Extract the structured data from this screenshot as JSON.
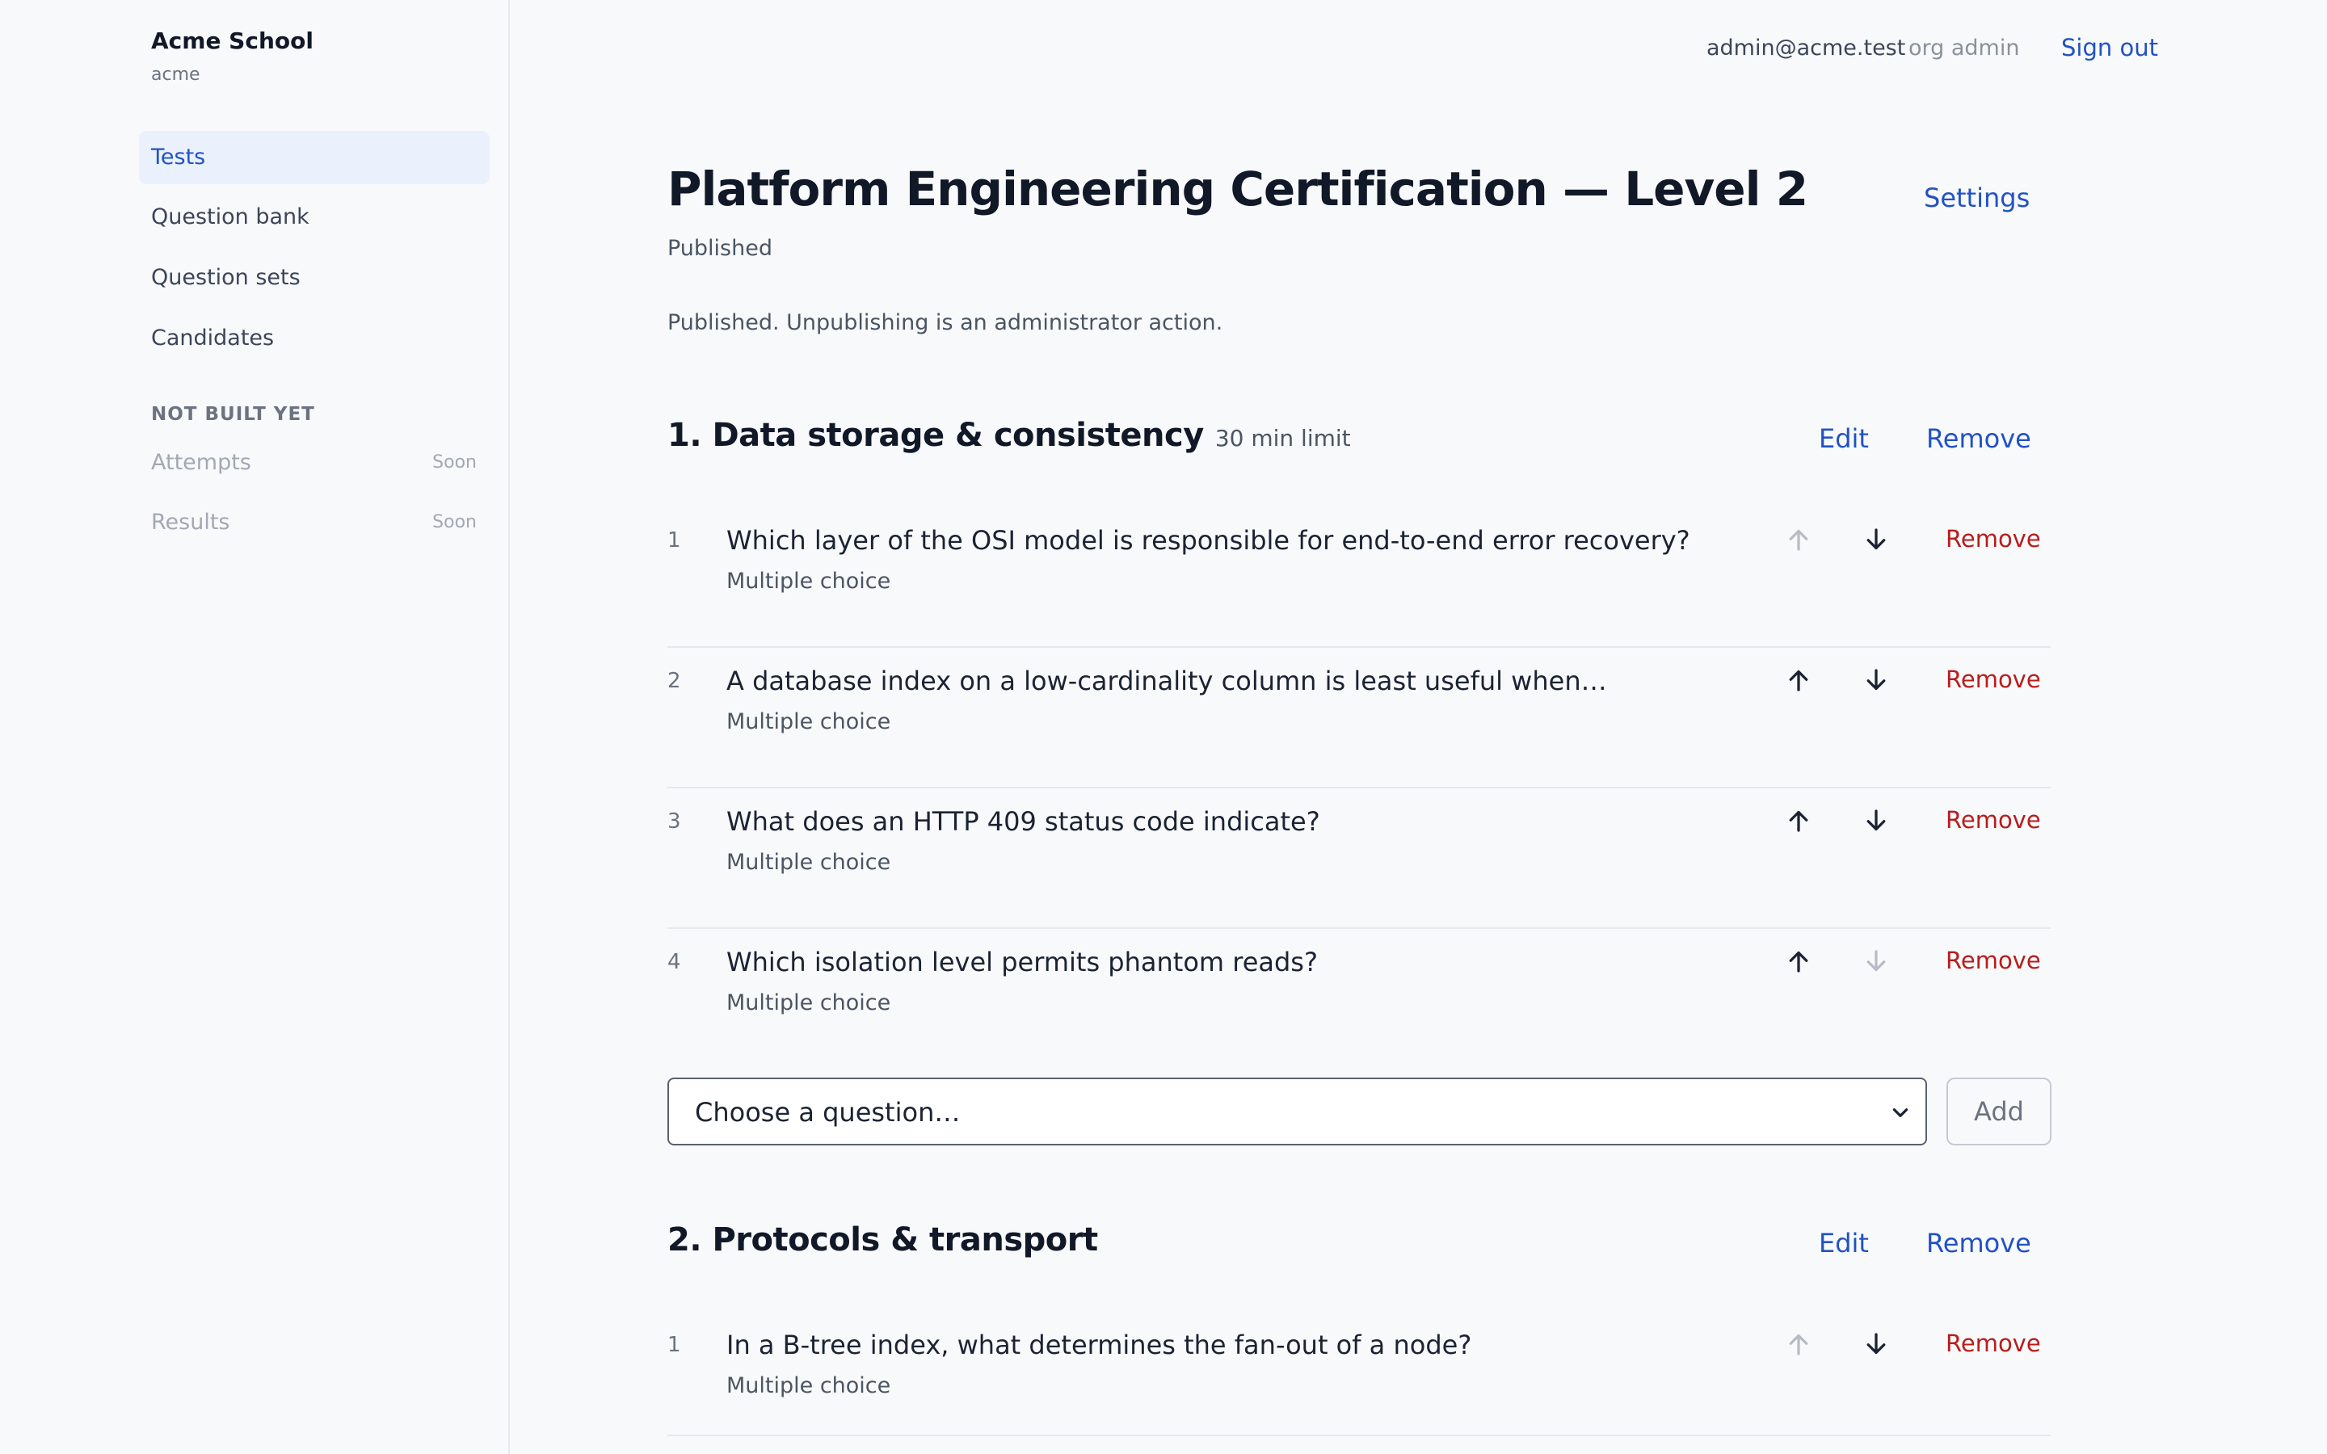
{
  "sidebar": {
    "org_name": "Acme School",
    "org_slug": "acme",
    "items": [
      {
        "label": "Tests"
      },
      {
        "label": "Question bank"
      },
      {
        "label": "Question sets"
      },
      {
        "label": "Candidates"
      }
    ],
    "section_heading": "NOT BUILT YET",
    "upcoming": [
      {
        "label": "Attempts",
        "tag": "Soon"
      },
      {
        "label": "Results",
        "tag": "Soon"
      }
    ]
  },
  "topbar": {
    "email": "admin@acme.test",
    "role": "org admin",
    "signout": "Sign out"
  },
  "page": {
    "title": "Platform Engineering Certification — Level 2",
    "status": "Published",
    "settings": "Settings",
    "notice": "Published. Unpublishing is an administrator action."
  },
  "sections": [
    {
      "title": "1. Data storage & consistency",
      "limit": "30 min limit",
      "edit": "Edit",
      "remove": "Remove",
      "questions": [
        {
          "num": "1",
          "text": "Which layer of the OSI model is responsible for end-to-end error recovery?",
          "type": "Multiple choice",
          "remove": "Remove"
        },
        {
          "num": "2",
          "text": "A database index on a low-cardinality column is least useful when…",
          "type": "Multiple choice",
          "remove": "Remove"
        },
        {
          "num": "3",
          "text": "What does an HTTP 409 status code indicate?",
          "type": "Multiple choice",
          "remove": "Remove"
        },
        {
          "num": "4",
          "text": "Which isolation level permits phantom reads?",
          "type": "Multiple choice",
          "remove": "Remove"
        }
      ],
      "select_placeholder": "Choose a question…",
      "add": "Add"
    },
    {
      "title": "2. Protocols & transport",
      "edit": "Edit",
      "remove": "Remove",
      "questions": [
        {
          "num": "1",
          "text": "In a B-tree index, what determines the fan-out of a node?",
          "type": "Multiple choice",
          "remove": "Remove"
        }
      ]
    }
  ],
  "colors": {
    "accent": "#2152c4",
    "danger": "#b91c1c",
    "active_bg": "#eaf1fd",
    "arrow_enabled": "#1b2333",
    "arrow_disabled": "#b7bcc6"
  },
  "icons": {
    "move_up": "arrow-up-icon",
    "move_down": "arrow-down-icon",
    "select": "chevron-down-icon"
  }
}
